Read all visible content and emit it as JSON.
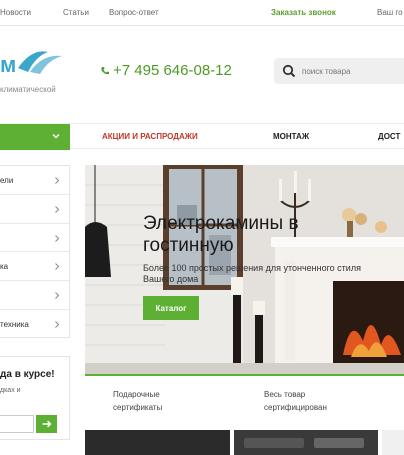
{
  "topbar": {
    "links": [
      "Новости",
      "Статьи",
      "Вопрос-ответ"
    ],
    "callback": "Заказать звонок",
    "account": "Ваш го"
  },
  "header": {
    "logo_tagline": "климатической",
    "phone": "+7 495 646-08-12",
    "search_placeholder": "поиск товара"
  },
  "nav": {
    "items": [
      "АКЦИИ И РАСПРОДАЖИ",
      "МОНТАЖ",
      "ДОСТ"
    ]
  },
  "sidebar": {
    "items": [
      "ели",
      "",
      "",
      "ка",
      "",
      "техника"
    ]
  },
  "subscribe": {
    "title": "да в курсе!",
    "text": "дках и"
  },
  "hero": {
    "title": "Электрокамины в гостинную",
    "subtitle": "Более 100 простых решения для утонченного стиля Вашего дома",
    "button": "Каталог"
  },
  "features": [
    {
      "line1": "Подарочные",
      "line2": "сертификаты"
    },
    {
      "line1": "Весь товар",
      "line2": "сертифицирован"
    }
  ],
  "colors": {
    "accent": "#5db034",
    "phone": "#4f9a26",
    "sale": "#c0392b"
  }
}
